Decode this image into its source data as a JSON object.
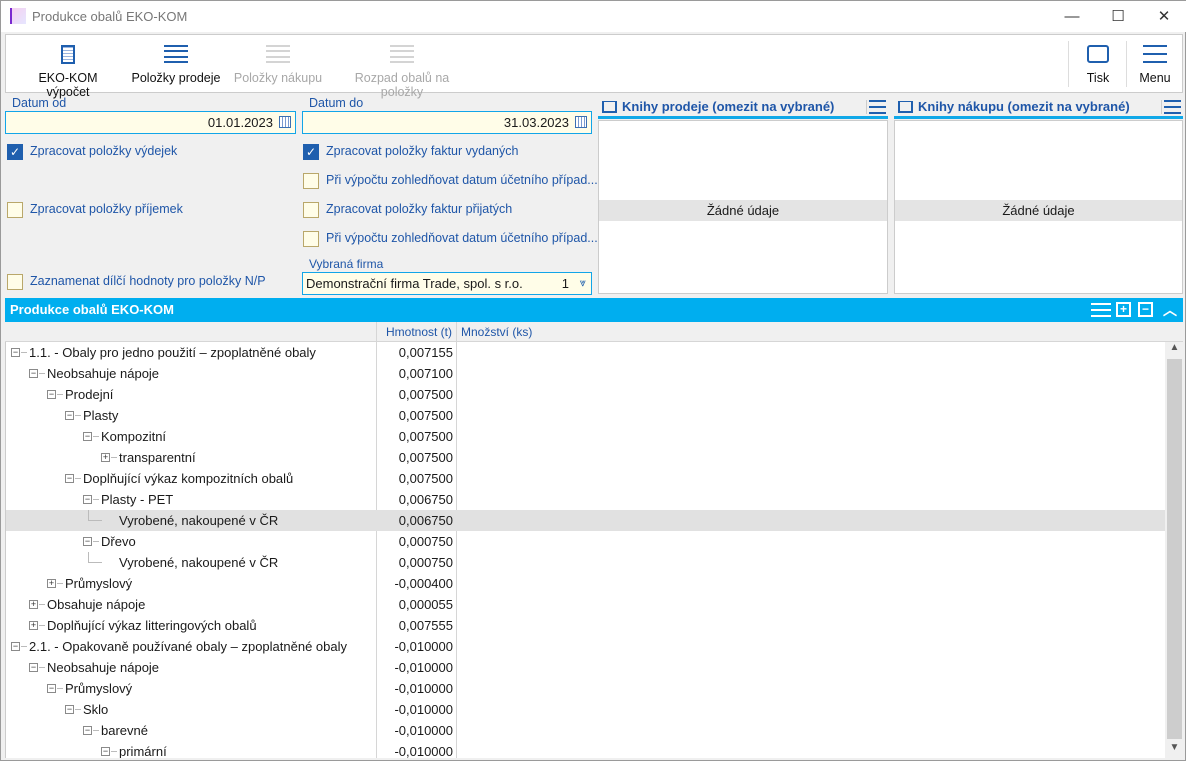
{
  "window": {
    "title": "Produkce obalů EKO-KOM",
    "app_icon": "K2",
    "minimize": "—",
    "maximize": "☐",
    "close": "✕"
  },
  "toolbar": {
    "buttons": [
      {
        "label": "EKO-KOM výpočet",
        "icon": "calculator-icon",
        "enabled": true
      },
      {
        "label": "Položky prodeje",
        "icon": "list-icon",
        "enabled": true
      },
      {
        "label": "Položky nákupu",
        "icon": "list-icon",
        "enabled": false
      },
      {
        "label": "Rozpad obalů na položky",
        "icon": "list-icon",
        "enabled": false
      }
    ],
    "print_label": "Tisk",
    "menu_label": "Menu"
  },
  "form": {
    "date_from_label": "Datum od",
    "date_from": "01.01.2023",
    "date_to_label": "Datum do",
    "date_to": "31.03.2023",
    "checks": [
      {
        "label": "Zpracovat položky výdejek",
        "checked": true
      },
      {
        "label": "Zpracovat položky příjemek",
        "checked": false
      },
      {
        "label": "Zaznamenat dílčí hodnoty pro položky N/P",
        "checked": false
      },
      {
        "label": "Zpracovat položky faktur vydaných",
        "checked": true
      },
      {
        "label": "Při výpočtu zohledňovat datum účetního případ...",
        "checked": false
      },
      {
        "label": "Zpracovat položky faktur přijatých",
        "checked": false
      },
      {
        "label": "Při výpočtu zohledňovat datum účetního případ...",
        "checked": false
      }
    ],
    "company_label": "Vybraná firma",
    "company": "Demonstrační firma Trade, spol. s r.o.",
    "company_no": "1"
  },
  "panels": [
    {
      "title": "Knihy prodeje (omezit na vybrané)",
      "empty": "Žádné údaje"
    },
    {
      "title": "Knihy nákupu (omezit na vybrané)",
      "empty": "Žádné údaje"
    }
  ],
  "grid": {
    "title": "Produkce obalů EKO-KOM",
    "columns": [
      "Hmotnost (t)",
      "Množství (ks)"
    ],
    "rows": [
      {
        "level": 0,
        "exp": "minus",
        "label": "1.1. - Obaly pro jedno použití – zpoplatněné obaly",
        "value": "0,007155"
      },
      {
        "level": 1,
        "exp": "minus",
        "label": "Neobsahuje nápoje",
        "value": "0,007100"
      },
      {
        "level": 2,
        "exp": "minus",
        "label": "Prodejní",
        "value": "0,007500"
      },
      {
        "level": 3,
        "exp": "minus",
        "label": "Plasty",
        "value": "0,007500"
      },
      {
        "level": 4,
        "exp": "minus",
        "label": "Kompozitní",
        "value": "0,007500"
      },
      {
        "level": 5,
        "exp": "plus",
        "label": "transparentní",
        "value": "0,007500"
      },
      {
        "level": 3,
        "exp": "minus",
        "label": "Doplňující výkaz kompozitních obalů",
        "value": "0,007500"
      },
      {
        "level": 4,
        "exp": "minus",
        "label": "Plasty - PET",
        "value": "0,006750"
      },
      {
        "level": 5,
        "exp": "leaf",
        "label": "Vyrobené, nakoupené v ČR",
        "value": "0,006750",
        "selected": true
      },
      {
        "level": 4,
        "exp": "minus",
        "label": "Dřevo",
        "value": "0,000750"
      },
      {
        "level": 5,
        "exp": "leaf",
        "label": "Vyrobené, nakoupené v ČR",
        "value": "0,000750"
      },
      {
        "level": 2,
        "exp": "plus",
        "label": "Průmyslový",
        "value": "-0,000400"
      },
      {
        "level": 1,
        "exp": "plus",
        "label": "Obsahuje nápoje",
        "value": "0,000055"
      },
      {
        "level": 1,
        "exp": "plus",
        "label": "Doplňující výkaz litteringových obalů",
        "value": "0,007555"
      },
      {
        "level": 0,
        "exp": "minus",
        "label": "2.1. - Opakovaně používané obaly – zpoplatněné obaly",
        "value": "-0,010000"
      },
      {
        "level": 1,
        "exp": "minus",
        "label": "Neobsahuje nápoje",
        "value": "-0,010000"
      },
      {
        "level": 2,
        "exp": "minus",
        "label": "Průmyslový",
        "value": "-0,010000"
      },
      {
        "level": 3,
        "exp": "minus",
        "label": "Sklo",
        "value": "-0,010000"
      },
      {
        "level": 4,
        "exp": "minus",
        "label": "barevné",
        "value": "-0,010000"
      },
      {
        "level": 5,
        "exp": "minus",
        "label": "primární",
        "value": "-0,010000"
      }
    ]
  },
  "colors": {
    "accent": "#00aeef",
    "label_blue": "#1f56a8",
    "field_bg": "#fffde8"
  }
}
